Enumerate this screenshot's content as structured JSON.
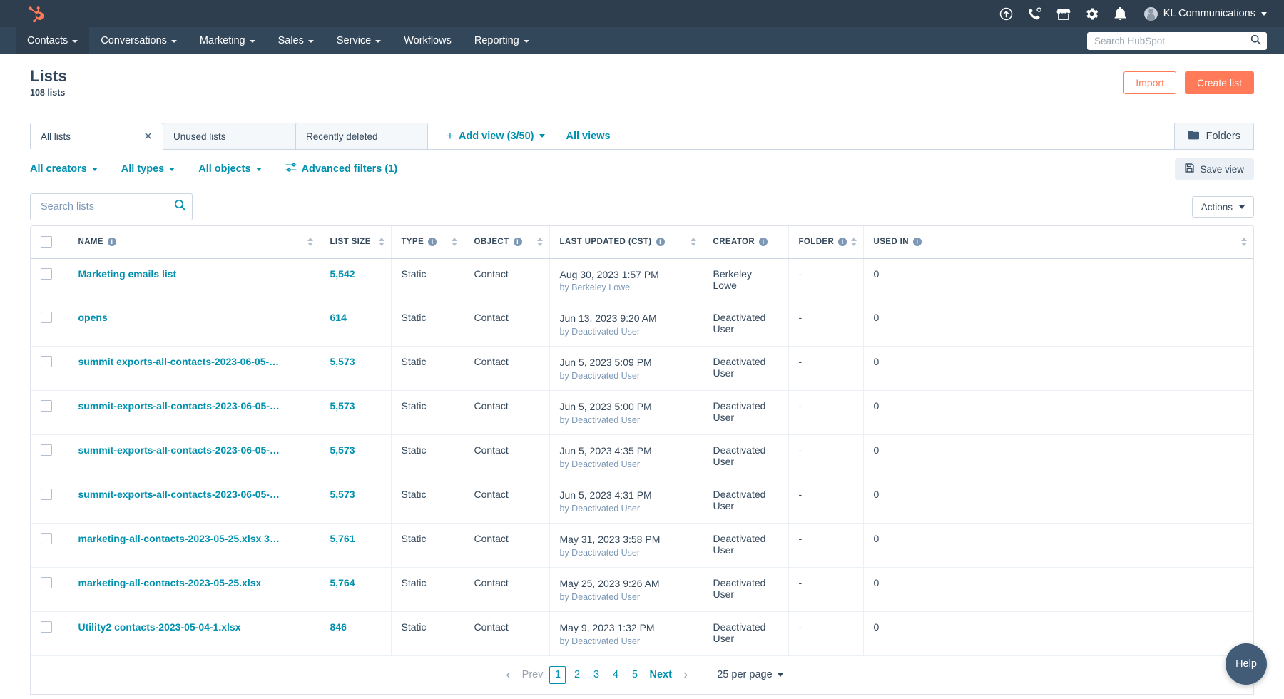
{
  "topnav": {
    "logo_icon": "hubspot-sprocket-logo",
    "icons": [
      {
        "name": "upgrade-icon",
        "glyph": "arrow-up-circle"
      },
      {
        "name": "calling-icon",
        "glyph": "phone"
      },
      {
        "name": "marketplace-icon",
        "glyph": "storefront"
      },
      {
        "name": "settings-icon",
        "glyph": "gear"
      },
      {
        "name": "notifications-icon",
        "glyph": "bell"
      }
    ],
    "account_name": "KL Communications"
  },
  "mainnav": {
    "items": [
      {
        "label": "Contacts",
        "has_caret": true,
        "active": true
      },
      {
        "label": "Conversations",
        "has_caret": true,
        "active": false
      },
      {
        "label": "Marketing",
        "has_caret": true,
        "active": false
      },
      {
        "label": "Sales",
        "has_caret": true,
        "active": false
      },
      {
        "label": "Service",
        "has_caret": true,
        "active": false
      },
      {
        "label": "Workflows",
        "has_caret": false,
        "active": false
      },
      {
        "label": "Reporting",
        "has_caret": true,
        "active": false
      }
    ],
    "search_placeholder": "Search HubSpot"
  },
  "header": {
    "title": "Lists",
    "subtitle": "108 lists",
    "import_label": "Import",
    "create_label": "Create list"
  },
  "tabs": [
    {
      "label": "All lists",
      "active": true,
      "closable": true
    },
    {
      "label": "Unused lists",
      "active": false,
      "closable": false
    },
    {
      "label": "Recently deleted",
      "active": false,
      "closable": false
    }
  ],
  "views": {
    "add_view_label": "Add view (3/50)",
    "all_views_label": "All views",
    "folders_label": "Folders"
  },
  "filters": {
    "creators": "All creators",
    "types": "All types",
    "objects": "All objects",
    "advanced": "Advanced filters (1)",
    "save_view": "Save view"
  },
  "toolbar": {
    "search_placeholder": "Search lists",
    "actions_label": "Actions"
  },
  "table": {
    "columns": [
      {
        "label": "NAME",
        "info": true,
        "sortable": true
      },
      {
        "label": "LIST SIZE",
        "info": false,
        "sortable": true
      },
      {
        "label": "TYPE",
        "info": true,
        "sortable": true
      },
      {
        "label": "OBJECT",
        "info": true,
        "sortable": true
      },
      {
        "label": "LAST UPDATED (CST)",
        "info": true,
        "sortable": true
      },
      {
        "label": "CREATOR",
        "info": true,
        "sortable": false
      },
      {
        "label": "FOLDER",
        "info": true,
        "sortable": true
      },
      {
        "label": "USED IN",
        "info": true,
        "sortable": true
      }
    ],
    "rows": [
      {
        "name": "Marketing emails list",
        "size": "5,542",
        "type": "Static",
        "object": "Contact",
        "updated": "Aug 30, 2023 1:57 PM",
        "updated_by": "by Berkeley Lowe",
        "creator": "Berkeley Lowe",
        "folder": "-",
        "used_in": "0"
      },
      {
        "name": "opens",
        "size": "614",
        "type": "Static",
        "object": "Contact",
        "updated": "Jun 13, 2023 9:20 AM",
        "updated_by": "by Deactivated User",
        "creator": "Deactivated User",
        "folder": "-",
        "used_in": "0"
      },
      {
        "name": "summit exports-all-contacts-2023-06-05-…",
        "size": "5,573",
        "type": "Static",
        "object": "Contact",
        "updated": "Jun 5, 2023 5:09 PM",
        "updated_by": "by Deactivated User",
        "creator": "Deactivated User",
        "folder": "-",
        "used_in": "0"
      },
      {
        "name": "summit-exports-all-contacts-2023-06-05-…",
        "size": "5,573",
        "type": "Static",
        "object": "Contact",
        "updated": "Jun 5, 2023 5:00 PM",
        "updated_by": "by Deactivated User",
        "creator": "Deactivated User",
        "folder": "-",
        "used_in": "0"
      },
      {
        "name": "summit-exports-all-contacts-2023-06-05-…",
        "size": "5,573",
        "type": "Static",
        "object": "Contact",
        "updated": "Jun 5, 2023 4:35 PM",
        "updated_by": "by Deactivated User",
        "creator": "Deactivated User",
        "folder": "-",
        "used_in": "0"
      },
      {
        "name": "summit-exports-all-contacts-2023-06-05-…",
        "size": "5,573",
        "type": "Static",
        "object": "Contact",
        "updated": "Jun 5, 2023 4:31 PM",
        "updated_by": "by Deactivated User",
        "creator": "Deactivated User",
        "folder": "-",
        "used_in": "0"
      },
      {
        "name": "marketing-all-contacts-2023-05-25.xlsx 3…",
        "size": "5,761",
        "type": "Static",
        "object": "Contact",
        "updated": "May 31, 2023 3:58 PM",
        "updated_by": "by Deactivated User",
        "creator": "Deactivated User",
        "folder": "-",
        "used_in": "0"
      },
      {
        "name": "marketing-all-contacts-2023-05-25.xlsx",
        "size": "5,764",
        "type": "Static",
        "object": "Contact",
        "updated": "May 25, 2023 9:26 AM",
        "updated_by": "by Deactivated User",
        "creator": "Deactivated User",
        "folder": "-",
        "used_in": "0"
      },
      {
        "name": "Utility2 contacts-2023-05-04-1.xlsx",
        "size": "846",
        "type": "Static",
        "object": "Contact",
        "updated": "May 9, 2023 1:32 PM",
        "updated_by": "by Deactivated User",
        "creator": "Deactivated User",
        "folder": "-",
        "used_in": "0"
      }
    ]
  },
  "pagination": {
    "prev_label": "Prev",
    "next_label": "Next",
    "pages": [
      "1",
      "2",
      "3",
      "4",
      "5"
    ],
    "current_page": "1",
    "per_page_label": "25 per page"
  },
  "help": {
    "label": "Help"
  },
  "colors": {
    "brand_orange": "#ff7a59",
    "nav_dark": "#2e3e4e",
    "nav_mid": "#33475b",
    "link_teal": "#0091ae"
  }
}
